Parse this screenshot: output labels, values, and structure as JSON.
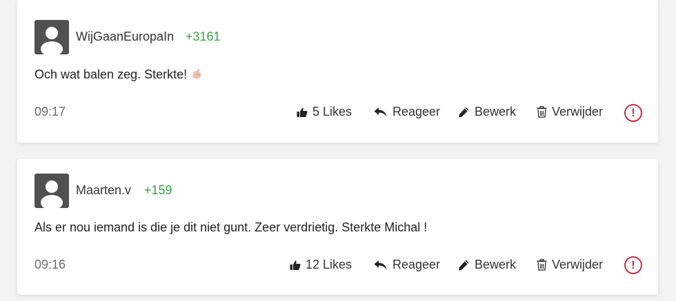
{
  "comments": [
    {
      "username": "WijGaanEuropaIn",
      "points": "+3161",
      "text": "Och wat balen zeg. Sterkte!",
      "emoji": "flexed-biceps",
      "time": "09:17",
      "likes_label": "5 Likes",
      "reply_label": "Reageer",
      "edit_label": "Bewerk",
      "delete_label": "Verwijder",
      "report_symbol": "!"
    },
    {
      "username": "Maarten.v",
      "points": "+159",
      "text": "Als er nou iemand is die je dit niet gunt. Zeer verdrietig. Sterkte Michal !",
      "time": "09:16",
      "likes_label": "12 Likes",
      "reply_label": "Reageer",
      "edit_label": "Bewerk",
      "delete_label": "Verwijder",
      "report_symbol": "!"
    }
  ],
  "colors": {
    "points": "#3aa346",
    "report": "#c62d3d",
    "avatar_bg": "#505050"
  }
}
